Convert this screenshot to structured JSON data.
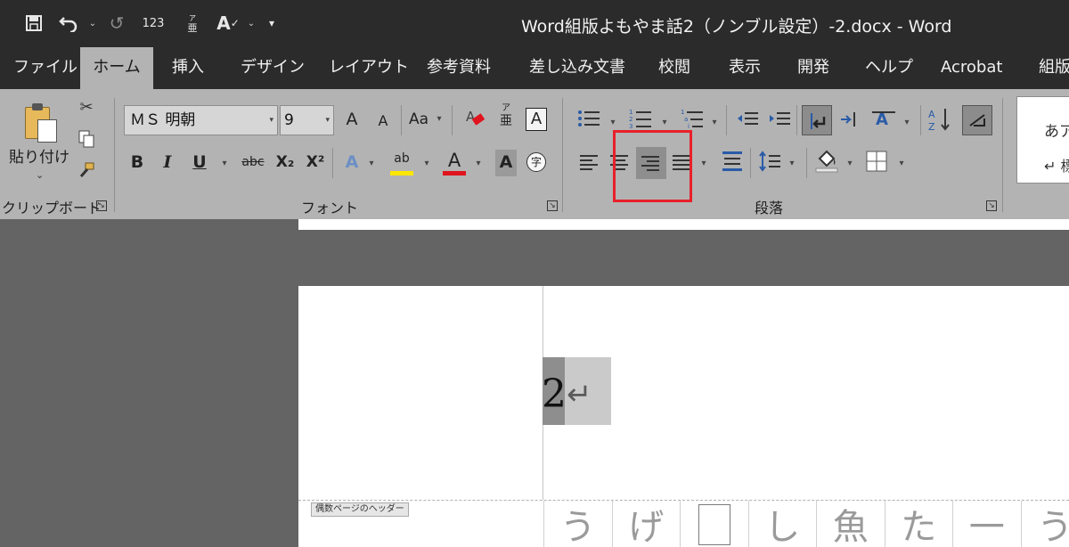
{
  "window": {
    "title": "Word組版よもやま話2（ノンブル設定）-2.docx  -  Word"
  },
  "qat": {
    "num_label": "123",
    "ruby_top": "ア",
    "ruby_bottom": "亜",
    "spell_label": "A"
  },
  "tabs": [
    {
      "label": "ファイル"
    },
    {
      "label": "ホーム"
    },
    {
      "label": "挿入"
    },
    {
      "label": "デザイン"
    },
    {
      "label": "レイアウト"
    },
    {
      "label": "参考資料"
    },
    {
      "label": "差し込み文書"
    },
    {
      "label": "校閲"
    },
    {
      "label": "表示"
    },
    {
      "label": "開発"
    },
    {
      "label": "ヘルプ"
    },
    {
      "label": "Acrobat"
    },
    {
      "label": "組版"
    }
  ],
  "clipboard": {
    "paste_label": "貼り付け",
    "group_label": "クリップボード"
  },
  "font": {
    "name": "ＭＳ 明朝",
    "size": "9",
    "grow": "A",
    "shrink": "A",
    "case": "Aa",
    "ruby_top": "ア",
    "ruby_bottom": "亜",
    "border_char": "A",
    "bold": "B",
    "italic": "I",
    "underline": "U",
    "strike": "abc",
    "sub": "X₂",
    "sup": "X²",
    "effects": "A",
    "highlight": "ab",
    "color": "A",
    "shade": "A",
    "enclose": "字",
    "group_label": "フォント"
  },
  "paragraph": {
    "group_label": "段落"
  },
  "styles": {
    "sample_top": "あア",
    "sample_bottom": "↵ 標"
  },
  "document": {
    "page_number": "2",
    "return_mark": "↵",
    "header_tag": "偶数ページのヘッダー",
    "cells": [
      "う",
      "げ",
      "",
      "し",
      "魚",
      "た",
      "一",
      "う"
    ]
  },
  "colors": {
    "titlebar": "#2b2b2b",
    "ribbon": "#b3b3b3",
    "highlight_bar": "#ffe600",
    "font_color_bar": "#e0141e",
    "callout_box": "#e8202a"
  }
}
